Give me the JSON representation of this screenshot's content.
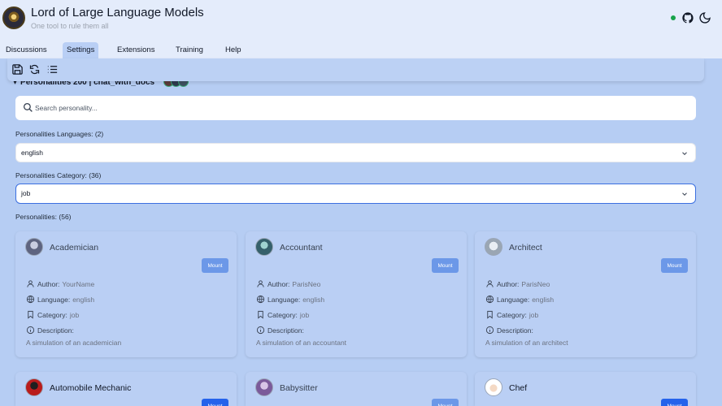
{
  "app": {
    "title": "Lord of Large Language Models",
    "subtitle": "One tool to rule them all"
  },
  "header_icons": [
    "status-dot",
    "github-icon",
    "moon-icon"
  ],
  "tabs": [
    {
      "label": "Discussions",
      "active": false
    },
    {
      "label": "Settings",
      "active": true
    },
    {
      "label": "Extensions",
      "active": false
    },
    {
      "label": "Training",
      "active": false
    },
    {
      "label": "Help",
      "active": false
    }
  ],
  "toolbar": [
    "save-icon",
    "refresh-icon",
    "list-icon"
  ],
  "section": {
    "title": "Personalities 200 | chat_with_docs"
  },
  "search": {
    "placeholder": "Search personality..."
  },
  "languages": {
    "label": "Personalities Languages: (2)",
    "value": "english"
  },
  "category": {
    "label": "Personalities Category: (36)",
    "value": "job"
  },
  "personalities_label": "Personalities: (56)",
  "card_labels": {
    "author": "Author:",
    "language": "Language:",
    "category": "Category:",
    "description": "Description:",
    "mount": "Mount"
  },
  "personalities": [
    {
      "name": "Academician",
      "author": "YourName",
      "language": "english",
      "category": "job",
      "description": "A simulation of an academician"
    },
    {
      "name": "Accountant",
      "author": "ParisNeo",
      "language": "english",
      "category": "job",
      "description": "A simulation of an accountant"
    },
    {
      "name": "Architect",
      "author": "ParisNeo",
      "language": "english",
      "category": "job",
      "description": "A simulation of an architect"
    },
    {
      "name": "Automobile Mechanic"
    },
    {
      "name": "Babysitter"
    },
    {
      "name": "Chef"
    }
  ],
  "colors": {
    "background": "#b6cdf3",
    "header": "#e4ecfb",
    "accent": "#2563eb",
    "status": "#16a34a"
  }
}
